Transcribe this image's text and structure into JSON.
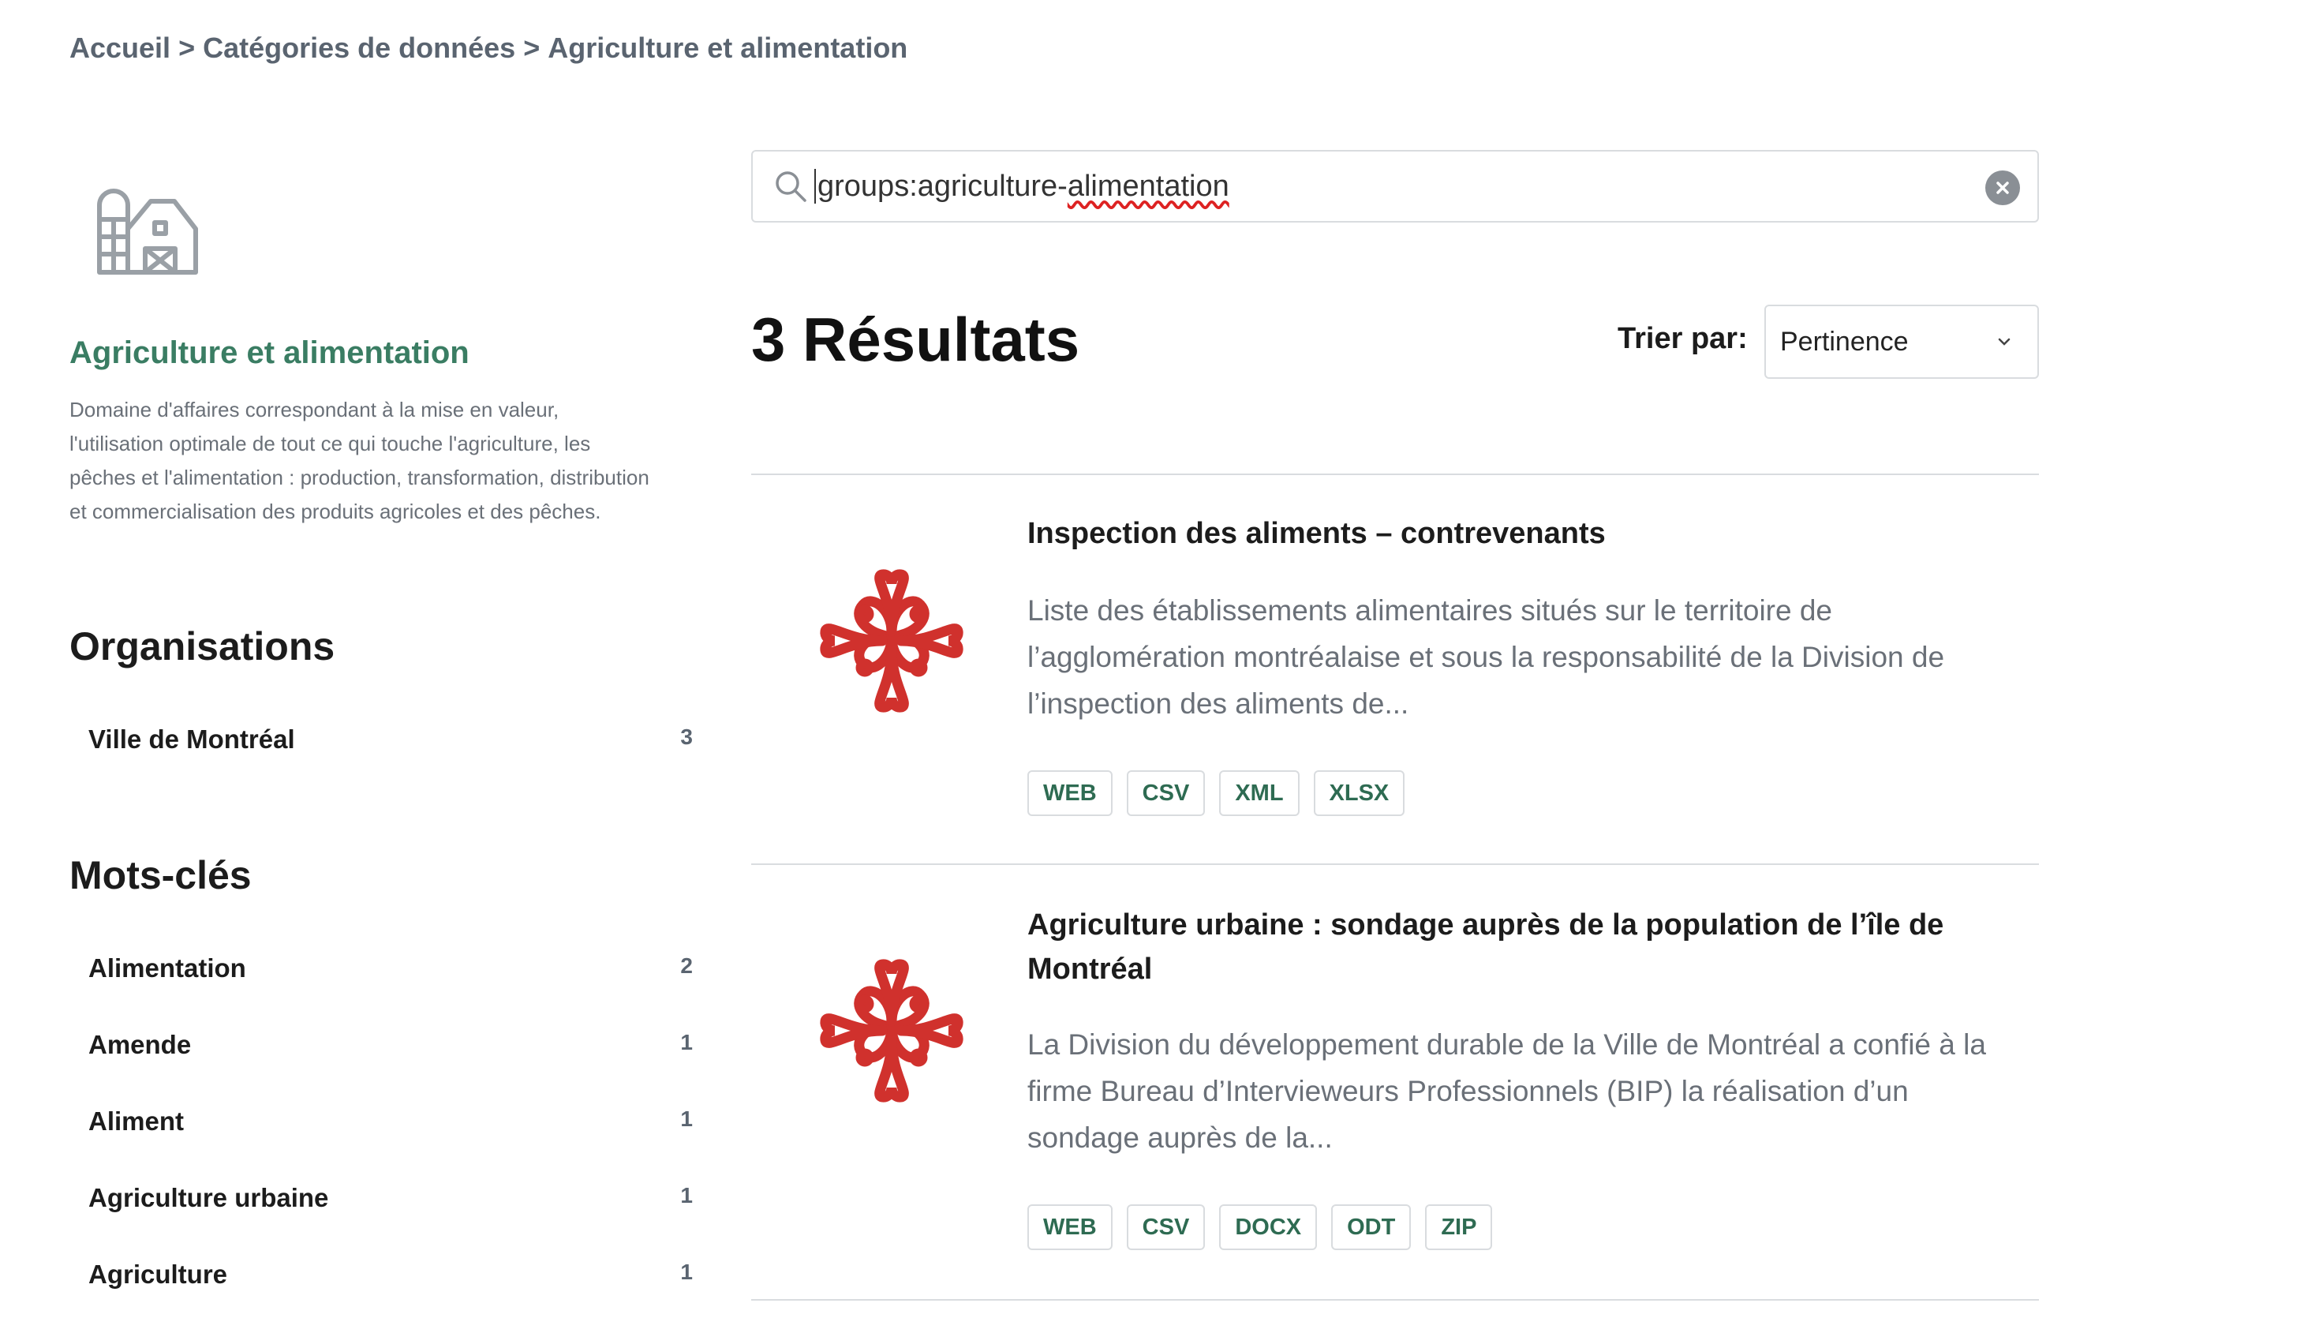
{
  "breadcrumb": {
    "items": [
      "Accueil",
      "Catégories de données",
      "Agriculture et alimentation"
    ],
    "separator": ">"
  },
  "category": {
    "icon": "farm-barn-icon",
    "title": "Agriculture et alimentation",
    "description": "Domaine d'affaires correspondant à la mise en valeur, l'utilisation optimale de tout ce qui touche l'agriculture, les pêches et l'alimentation : production, transformation, distribution et commercialisation des produits agricoles et des pêches."
  },
  "organisations": {
    "heading": "Organisations",
    "items": [
      {
        "label": "Ville de Montréal",
        "count": "3"
      }
    ]
  },
  "keywords": {
    "heading": "Mots-clés",
    "items": [
      {
        "label": "Alimentation",
        "count": "2"
      },
      {
        "label": "Amende",
        "count": "1"
      },
      {
        "label": "Aliment",
        "count": "1"
      },
      {
        "label": "Agriculture urbaine",
        "count": "1"
      },
      {
        "label": "Agriculture",
        "count": "1"
      }
    ]
  },
  "search": {
    "value_prefix": "groups:agriculture-",
    "value_suffix": "alimentation"
  },
  "results": {
    "title": "3 Résultats",
    "sort_label": "Trier par:",
    "sort_value": "Pertinence",
    "items": [
      {
        "title": "Inspection des aliments – contrevenants",
        "description": "Liste des établissements alimentaires situés sur le territoire de l’agglomération montréalaise et sous la responsabilité de la Division de l’inspection des aliments de...",
        "formats": [
          "WEB",
          "CSV",
          "XML",
          "XLSX"
        ]
      },
      {
        "title": "Agriculture urbaine : sondage auprès de la population de l’île de Montréal",
        "description": "La Division du développement durable de la Ville de Montréal a confié à la firme Bureau d’Intervieweurs Professionnels (BIP) la réalisation d’un sondage auprès de la...",
        "formats": [
          "WEB",
          "CSV",
          "DOCX",
          "ODT",
          "ZIP"
        ]
      }
    ]
  },
  "colors": {
    "accent": "#3a7d63",
    "logo_red": "#d0312d"
  }
}
